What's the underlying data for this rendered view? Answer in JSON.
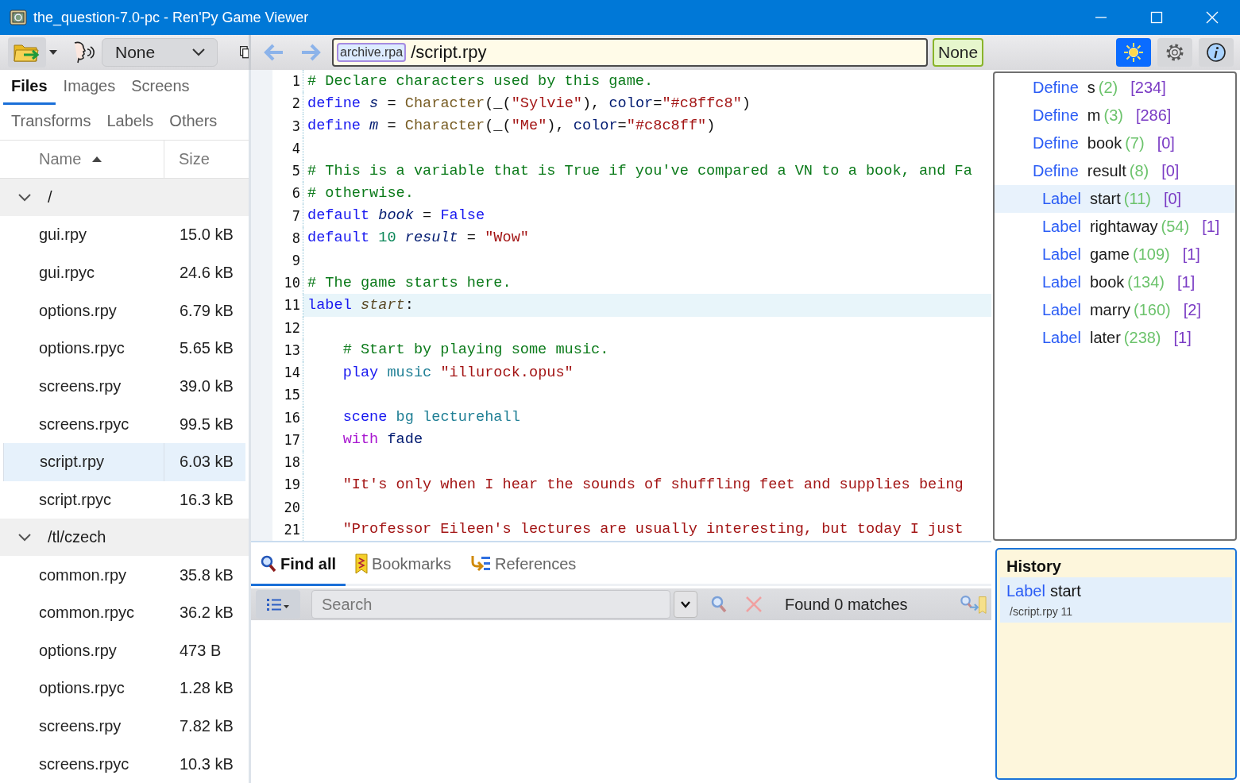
{
  "window": {
    "title": "the_question-7.0-pc - Ren'Py Game Viewer"
  },
  "toolbar": {
    "voice": {
      "value": "None"
    },
    "location": {
      "archive": "archive.rpa",
      "path": "/script.rpy"
    },
    "mode_button": "None",
    "toggles": [
      {
        "kind": "theme",
        "selected": true
      },
      {
        "kind": "settings",
        "selected": false
      },
      {
        "kind": "info",
        "selected": false
      }
    ]
  },
  "files_panel": {
    "tabs": [
      {
        "label": "Files",
        "selected": true
      },
      {
        "label": "Images",
        "selected": false
      },
      {
        "label": "Screens",
        "selected": false
      },
      {
        "label": "Transforms",
        "selected": false
      },
      {
        "label": "Labels",
        "selected": false
      },
      {
        "label": "Others",
        "selected": false
      }
    ],
    "columns": [
      {
        "label": "Name",
        "sort_ascending": true
      },
      {
        "label": "Size",
        "sort_ascending": false
      }
    ],
    "tree": [
      {
        "name": "/",
        "expanded": true,
        "children": [
          {
            "name": "gui.rpy",
            "size": "15.0 kB",
            "selected": false
          },
          {
            "name": "gui.rpyc",
            "size": "24.6 kB",
            "selected": false
          },
          {
            "name": "options.rpy",
            "size": "6.79 kB",
            "selected": false
          },
          {
            "name": "options.rpyc",
            "size": "5.65 kB",
            "selected": false
          },
          {
            "name": "screens.rpy",
            "size": "39.0 kB",
            "selected": false
          },
          {
            "name": "screens.rpyc",
            "size": "99.5 kB",
            "selected": false
          },
          {
            "name": "script.rpy",
            "size": "6.03 kB",
            "selected": true
          },
          {
            "name": "script.rpyc",
            "size": "16.3 kB",
            "selected": false
          }
        ]
      },
      {
        "name": "/tl/czech",
        "expanded": true,
        "children": [
          {
            "name": "common.rpy",
            "size": "35.8 kB",
            "selected": false
          },
          {
            "name": "common.rpyc",
            "size": "36.2 kB",
            "selected": false
          },
          {
            "name": "options.rpy",
            "size": "473 B",
            "selected": false
          },
          {
            "name": "options.rpyc",
            "size": "1.28 kB",
            "selected": false
          },
          {
            "name": "screens.rpy",
            "size": "7.82 kB",
            "selected": false
          },
          {
            "name": "screens.rpyc",
            "size": "10.3 kB",
            "selected": false
          }
        ]
      }
    ]
  },
  "editor": {
    "lines": [
      {
        "number": "1",
        "current": false,
        "tokens": [
          {
            "text": "# Declare characters used by this game.",
            "kind": "comment"
          }
        ]
      },
      {
        "number": "2",
        "current": false,
        "tokens": [
          {
            "text": "define ",
            "kind": "keyword"
          },
          {
            "text": "s",
            "kind": "variable"
          },
          {
            "text": " = ",
            "kind": "plain"
          },
          {
            "text": "Character",
            "kind": "function"
          },
          {
            "text": "(_(",
            "kind": "plain"
          },
          {
            "text": "\"Sylvie\"",
            "kind": "string"
          },
          {
            "text": "), ",
            "kind": "plain"
          },
          {
            "text": "color",
            "kind": "parameter"
          },
          {
            "text": "=",
            "kind": "plain"
          },
          {
            "text": "\"#c8ffc8\"",
            "kind": "string"
          },
          {
            "text": ")",
            "kind": "plain"
          }
        ]
      },
      {
        "number": "3",
        "current": false,
        "tokens": [
          {
            "text": "define ",
            "kind": "keyword"
          },
          {
            "text": "m",
            "kind": "variable"
          },
          {
            "text": " = ",
            "kind": "plain"
          },
          {
            "text": "Character",
            "kind": "function"
          },
          {
            "text": "(_(",
            "kind": "plain"
          },
          {
            "text": "\"Me\"",
            "kind": "string"
          },
          {
            "text": "), ",
            "kind": "plain"
          },
          {
            "text": "color",
            "kind": "parameter"
          },
          {
            "text": "=",
            "kind": "plain"
          },
          {
            "text": "\"#c8c8ff\"",
            "kind": "string"
          },
          {
            "text": ")",
            "kind": "plain"
          }
        ]
      },
      {
        "number": "4",
        "current": false
      },
      {
        "number": "5",
        "current": false,
        "tokens": [
          {
            "text": "# This is a variable that is True if you've compared a VN to a book, and Fa",
            "kind": "comment"
          }
        ]
      },
      {
        "number": "6",
        "current": false,
        "tokens": [
          {
            "text": "# otherwise.",
            "kind": "comment"
          }
        ]
      },
      {
        "number": "7",
        "current": false,
        "tokens": [
          {
            "text": "default ",
            "kind": "keyword"
          },
          {
            "text": "book",
            "kind": "variable"
          },
          {
            "text": " = ",
            "kind": "plain"
          },
          {
            "text": "False",
            "kind": "keyword"
          }
        ]
      },
      {
        "number": "8",
        "current": false,
        "tokens": [
          {
            "text": "default ",
            "kind": "keyword"
          },
          {
            "text": "10 ",
            "kind": "number"
          },
          {
            "text": "result",
            "kind": "variable"
          },
          {
            "text": " = ",
            "kind": "plain"
          },
          {
            "text": "\"Wow\"",
            "kind": "string"
          }
        ]
      },
      {
        "number": "9",
        "current": false
      },
      {
        "number": "10",
        "current": false,
        "tokens": [
          {
            "text": "# The game starts here.",
            "kind": "comment"
          }
        ]
      },
      {
        "number": "11",
        "current": true,
        "tokens": [
          {
            "text": "label ",
            "kind": "keyword"
          },
          {
            "text": "start",
            "kind": "label"
          },
          {
            "text": ":",
            "kind": "plain"
          }
        ]
      },
      {
        "number": "12",
        "current": false
      },
      {
        "number": "13",
        "current": false,
        "tokens": [
          {
            "text": "    # Start by playing some music.",
            "kind": "comment"
          }
        ]
      },
      {
        "number": "14",
        "current": false,
        "tokens": [
          {
            "text": "    play ",
            "kind": "keyword"
          },
          {
            "text": "music ",
            "kind": "identifier"
          },
          {
            "text": "\"illurock.opus\"",
            "kind": "string"
          }
        ]
      },
      {
        "number": "15",
        "current": false
      },
      {
        "number": "16",
        "current": false,
        "tokens": [
          {
            "text": "    scene ",
            "kind": "keyword"
          },
          {
            "text": "bg lecturehall",
            "kind": "identifier"
          }
        ]
      },
      {
        "number": "17",
        "current": false,
        "tokens": [
          {
            "text": "    with ",
            "kind": "control"
          },
          {
            "text": "fade",
            "kind": "parameter"
          }
        ]
      },
      {
        "number": "18",
        "current": false
      },
      {
        "number": "19",
        "current": false,
        "tokens": [
          {
            "text": "    \"It's only when I hear the sounds of shuffling feet and supplies being",
            "kind": "string"
          }
        ]
      },
      {
        "number": "20",
        "current": false
      },
      {
        "number": "21",
        "current": false,
        "tokens": [
          {
            "text": "    \"Professor Eileen's lectures are usually interesting, but today I just",
            "kind": "string"
          }
        ]
      }
    ]
  },
  "outline": {
    "items": [
      {
        "kind": "define",
        "keyword": "Define",
        "name": "s",
        "line": "(2)",
        "count": "[234]",
        "selected": false
      },
      {
        "kind": "define",
        "keyword": "Define",
        "name": "m",
        "line": "(3)",
        "count": "[286]",
        "selected": false
      },
      {
        "kind": "define",
        "keyword": "Define",
        "name": "book",
        "line": "(7)",
        "count": "[0]",
        "selected": false
      },
      {
        "kind": "define",
        "keyword": "Define",
        "name": "result",
        "line": "(8)",
        "count": "[0]",
        "selected": false
      },
      {
        "kind": "label",
        "keyword": "Label",
        "name": "start",
        "line": "(11)",
        "count": "[0]",
        "selected": true
      },
      {
        "kind": "label",
        "keyword": "Label",
        "name": "rightaway",
        "line": "(54)",
        "count": "[1]",
        "selected": false
      },
      {
        "kind": "label",
        "keyword": "Label",
        "name": "game",
        "line": "(109)",
        "count": "[1]",
        "selected": false
      },
      {
        "kind": "label",
        "keyword": "Label",
        "name": "book",
        "line": "(134)",
        "count": "[1]",
        "selected": false
      },
      {
        "kind": "label",
        "keyword": "Label",
        "name": "marry",
        "line": "(160)",
        "count": "[2]",
        "selected": false
      },
      {
        "kind": "label",
        "keyword": "Label",
        "name": "later",
        "line": "(238)",
        "count": "[1]",
        "selected": false
      }
    ]
  },
  "find_panel": {
    "tabs": [
      {
        "kind": "find",
        "label": "Find all",
        "selected": true
      },
      {
        "kind": "bookmarks",
        "label": "Bookmarks",
        "selected": false
      },
      {
        "kind": "references",
        "label": "References",
        "selected": false
      }
    ],
    "search": {
      "placeholder": "Search"
    },
    "status": "Found 0 matches"
  },
  "history": {
    "title": "History",
    "items": [
      {
        "keyword": "Label",
        "name": "start",
        "location": "/script.rpy 11",
        "selected": true
      }
    ]
  }
}
